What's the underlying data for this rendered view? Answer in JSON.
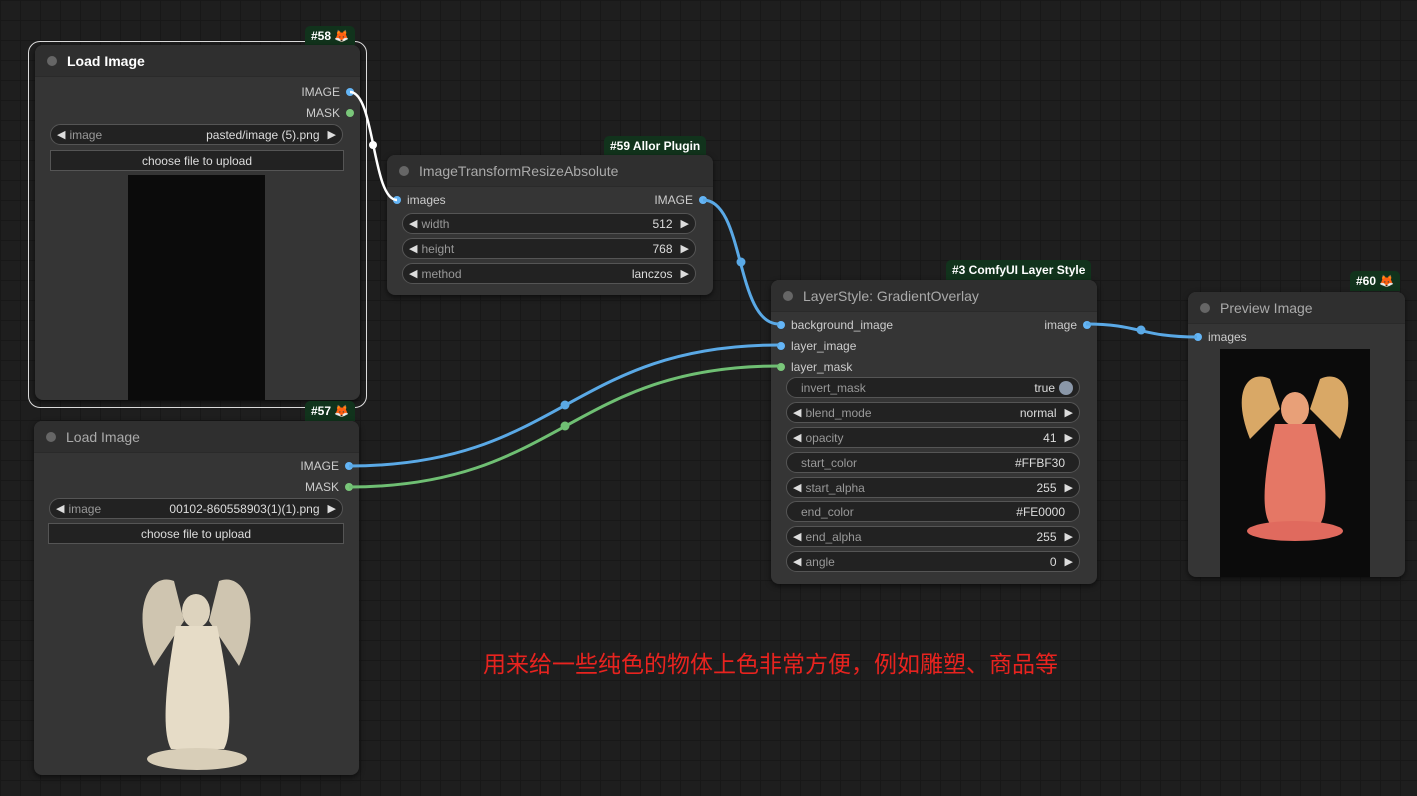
{
  "nodes": {
    "n58": {
      "badge": "#58",
      "title": "Load Image",
      "outputs": [
        "IMAGE",
        "MASK"
      ],
      "image_label": "image",
      "image_value": "pasted/image (5).png",
      "upload": "choose file to upload"
    },
    "n57": {
      "badge": "#57",
      "title": "Load Image",
      "outputs": [
        "IMAGE",
        "MASK"
      ],
      "image_label": "image",
      "image_value": "00102-860558903(1)(1).png",
      "upload": "choose file to upload"
    },
    "n59": {
      "badge": "#59 Allor Plugin",
      "title": "ImageTransformResizeAbsolute",
      "input": "images",
      "output": "IMAGE",
      "widgets": [
        {
          "label": "width",
          "value": "512"
        },
        {
          "label": "height",
          "value": "768"
        },
        {
          "label": "method",
          "value": "lanczos"
        }
      ]
    },
    "n3": {
      "badge": "#3 ComfyUI Layer Style",
      "title": "LayerStyle: GradientOverlay",
      "inputs": [
        "background_image",
        "layer_image",
        "layer_mask"
      ],
      "output": "image",
      "widgets": [
        {
          "label": "invert_mask",
          "value": "true"
        },
        {
          "label": "blend_mode",
          "value": "normal"
        },
        {
          "label": "opacity",
          "value": "41"
        },
        {
          "label": "start_color",
          "value": "#FFBF30"
        },
        {
          "label": "start_alpha",
          "value": "255"
        },
        {
          "label": "end_color",
          "value": "#FE0000"
        },
        {
          "label": "end_alpha",
          "value": "255"
        },
        {
          "label": "angle",
          "value": "0"
        }
      ]
    },
    "n60": {
      "badge": "#60",
      "title": "Preview Image",
      "input": "images"
    }
  },
  "note": "用来给一些纯色的物体上色非常方便，例如雕塑、商品等",
  "colors": {
    "image_link": "#5aa9e6",
    "mask_link": "#6fbf73",
    "selected_link": "#ffffff",
    "note": "#e8231f"
  }
}
